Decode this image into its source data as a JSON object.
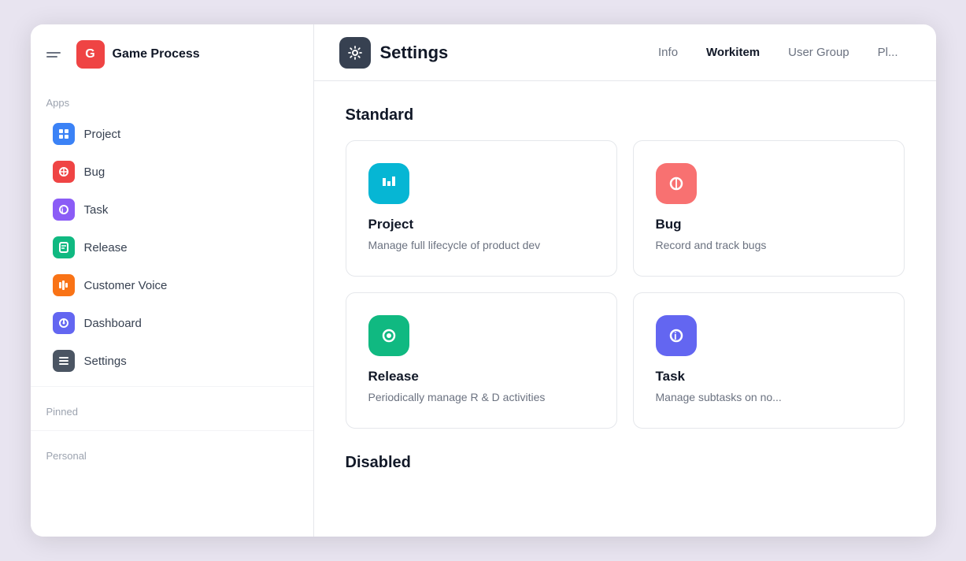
{
  "sidebar": {
    "menu_label": "Menu",
    "workspace": {
      "initial": "G",
      "name": "Game Process"
    },
    "apps_label": "Apps",
    "nav_items": [
      {
        "id": "project",
        "label": "Project",
        "icon_color": "#3b82f6",
        "icon_symbol": "⚑"
      },
      {
        "id": "bug",
        "label": "Bug",
        "icon_color": "#ef4444",
        "icon_symbol": "⊘"
      },
      {
        "id": "task",
        "label": "Task",
        "icon_color": "#8b5cf6",
        "icon_symbol": "ℹ"
      },
      {
        "id": "release",
        "label": "Release",
        "icon_color": "#10b981",
        "icon_symbol": "▣"
      },
      {
        "id": "customer-voice",
        "label": "Customer Voice",
        "icon_color": "#f97316",
        "icon_symbol": "▐"
      },
      {
        "id": "dashboard",
        "label": "Dashboard",
        "icon_color": "#6366f1",
        "icon_symbol": "⊕"
      },
      {
        "id": "settings",
        "label": "Settings",
        "icon_color": "#4b5563",
        "icon_symbol": "⊞"
      }
    ],
    "pinned_label": "Pinned",
    "personal_label": "Personal"
  },
  "header": {
    "title": "Settings",
    "icon": "⚙",
    "tabs": [
      {
        "id": "info",
        "label": "Info",
        "active": false
      },
      {
        "id": "workitem",
        "label": "Workitem",
        "active": true
      },
      {
        "id": "user-group",
        "label": "User Group",
        "active": false
      },
      {
        "id": "pl",
        "label": "Pl...",
        "active": false
      }
    ]
  },
  "standard_section": {
    "title": "Standard",
    "cards": [
      {
        "id": "project-card",
        "name": "Project",
        "desc": "Manage full lifecycle of product dev",
        "icon_color": "#06b6d4",
        "icon_symbol": "⚑"
      },
      {
        "id": "bug-card",
        "name": "Bug",
        "desc": "Record and track bugs",
        "icon_color": "#f87171",
        "icon_symbol": "⊘"
      },
      {
        "id": "release-card",
        "name": "Release",
        "desc": "Periodically manage R & D activities",
        "icon_color": "#10b981",
        "icon_symbol": "⊙"
      },
      {
        "id": "task-card",
        "name": "Task",
        "desc": "Manage subtasks on no...",
        "icon_color": "#6366f1",
        "icon_symbol": "ℹ"
      }
    ]
  },
  "disabled_section": {
    "title": "Disabled"
  }
}
